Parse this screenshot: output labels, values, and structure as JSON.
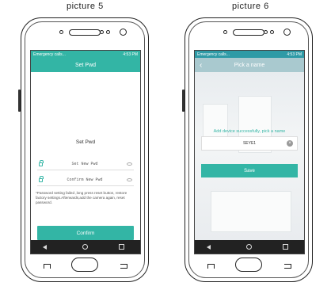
{
  "captions": {
    "left": "picture 5",
    "right": "picture 6"
  },
  "phone_left": {
    "status": {
      "left": "Emergency calls...",
      "right": "4:53 PM"
    },
    "title": "Set Pwd",
    "form_title": "Set Pwd",
    "new_pwd_placeholder": "Set New Pwd",
    "confirm_pwd_placeholder": "Confirm New Pwd",
    "note": "*Password setting failed ,long press reset button, restore factory settings.Afterwards,add the camera again, reset password.",
    "confirm_label": "Confirm",
    "accent": "#33b5a5"
  },
  "phone_right": {
    "status": {
      "left": "Emergency calls...",
      "right": "4:53 PM"
    },
    "title": "Pick a name",
    "message": "Add device successfully, pick a name",
    "name_value": "SEYE1",
    "save_label": "Save"
  }
}
